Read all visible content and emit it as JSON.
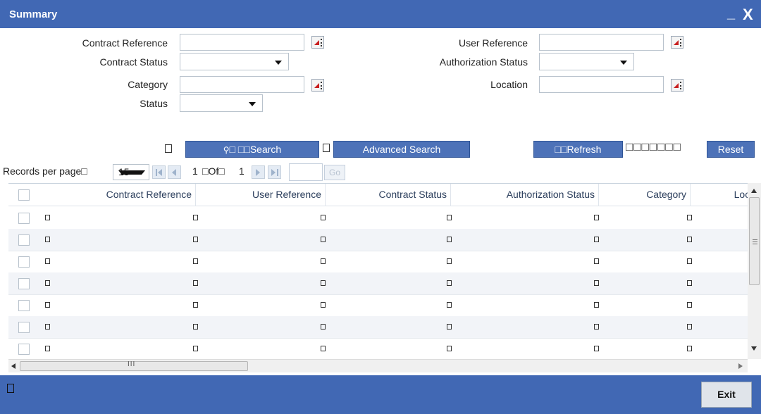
{
  "window": {
    "title": "Summary",
    "minimize_glyph": "_",
    "close_glyph": "X"
  },
  "form": {
    "contract_reference": {
      "label": "Contract Reference",
      "value": ""
    },
    "user_reference": {
      "label": "User Reference",
      "value": ""
    },
    "contract_status": {
      "label": "Contract Status",
      "value": ""
    },
    "authorization_status": {
      "label": "Authorization Status",
      "value": ""
    },
    "category": {
      "label": "Category",
      "value": ""
    },
    "location": {
      "label": "Location",
      "value": ""
    },
    "status": {
      "label": "Status",
      "value": ""
    }
  },
  "actions": {
    "search": "Search",
    "search_prefix_glyphs": "□ □□",
    "advanced_search": "Advanced Search",
    "refresh": "□□Refresh",
    "reset": "Reset",
    "spacer_glyphs": "□□□□□□□"
  },
  "pager": {
    "records_per_page_label": "Records per page□",
    "records_per_page": "15",
    "current_page": "1",
    "of_label": "□Of□",
    "total_pages": "1",
    "go_label": "Go"
  },
  "grid": {
    "columns": [
      "Contract Reference",
      "User Reference",
      "Contract Status",
      "Authorization Status",
      "Category",
      "Loca"
    ],
    "row_count": 7
  },
  "footer": {
    "exit_label": "Exit"
  }
}
